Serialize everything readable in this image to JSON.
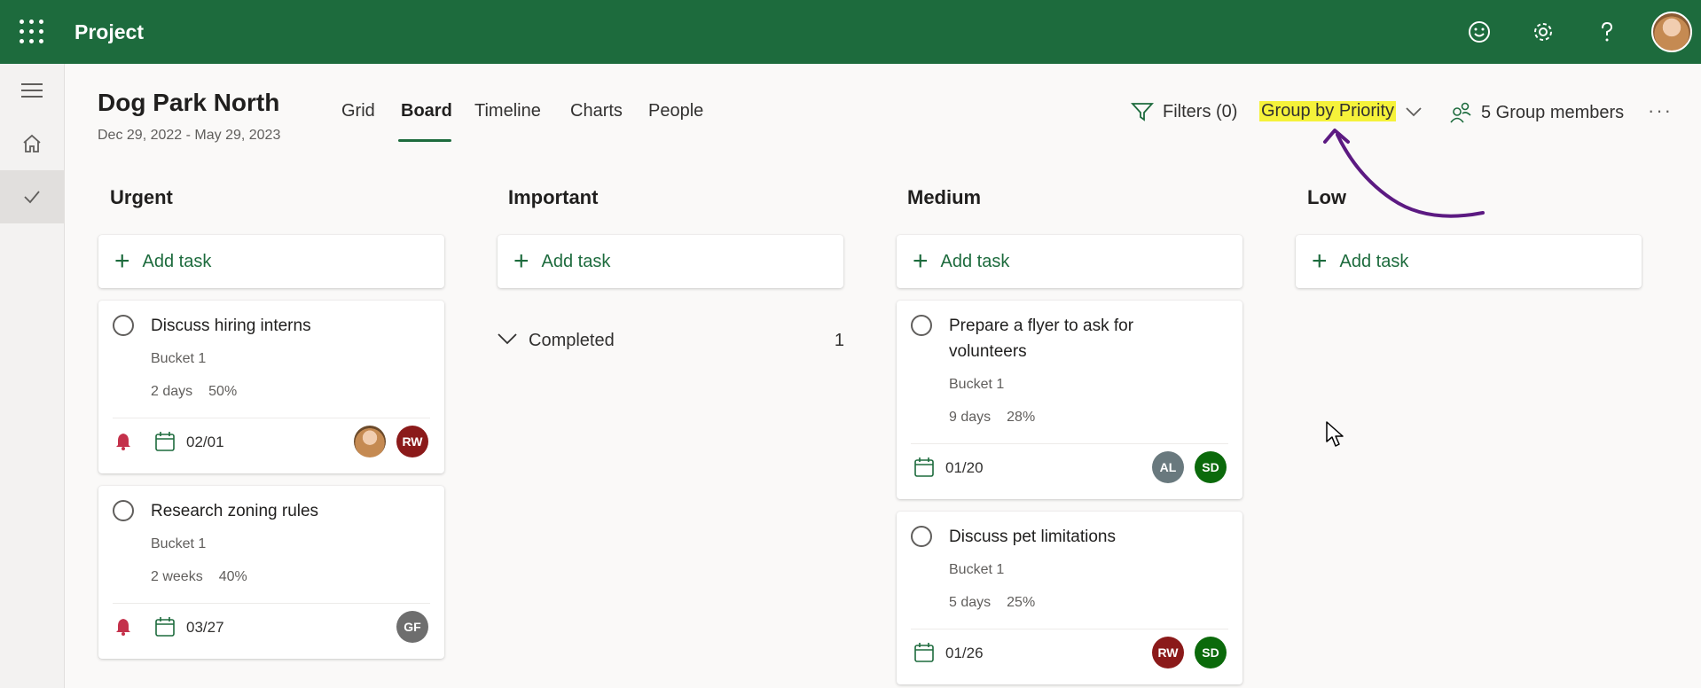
{
  "app": {
    "title": "Project"
  },
  "plan": {
    "title": "Dog Park North",
    "dates": "Dec 29, 2022 - May 29, 2023"
  },
  "tabs": [
    {
      "label": "Grid"
    },
    {
      "label": "Board",
      "active": true
    },
    {
      "label": "Timeline"
    },
    {
      "label": "Charts"
    },
    {
      "label": "People"
    }
  ],
  "toolbar": {
    "filters_label": "Filters (0)",
    "group_by_label": "Group by Priority",
    "members_label": "5 Group members",
    "more_label": "···"
  },
  "add_task_label": "Add task",
  "columns": [
    {
      "title": "Urgent",
      "tasks": [
        {
          "title": "Discuss hiring interns",
          "bucket": "Bucket 1",
          "duration": "2 days",
          "progress": "50%",
          "due": "02/01",
          "assignees": [
            "photo",
            "RW"
          ]
        },
        {
          "title": "Research zoning rules",
          "bucket": "Bucket 1",
          "duration": "2 weeks",
          "progress": "40%",
          "due": "03/27",
          "assignees": [
            "GF"
          ]
        }
      ]
    },
    {
      "title": "Important",
      "completed": {
        "label": "Completed",
        "count": "1"
      }
    },
    {
      "title": "Medium",
      "tasks": [
        {
          "title": "Prepare a flyer to ask for volunteers",
          "bucket": "Bucket 1",
          "duration": "9 days",
          "progress": "28%",
          "due": "01/20",
          "assignees": [
            "AL",
            "SD"
          ]
        },
        {
          "title": "Discuss pet limitations",
          "bucket": "Bucket 1",
          "duration": "5 days",
          "progress": "25%",
          "due": "01/26",
          "assignees": [
            "RW",
            "SD"
          ]
        }
      ]
    },
    {
      "title": "Low"
    }
  ],
  "colors": {
    "brand": "#1d6b3d",
    "urgent_bell": "#c4314b",
    "badge_rw": "#8b1a1a",
    "badge_gf": "#6e6e6e",
    "badge_al": "#69797e",
    "badge_sd": "#0b6a0b",
    "highlight": "#f5f23a",
    "annotation_arrow": "#5c1a82"
  },
  "icons": [
    "waffle-icon",
    "smiley-icon",
    "gear-icon",
    "help-icon",
    "hamburger-icon",
    "home-icon",
    "check-icon",
    "filter-icon",
    "chevron-down-icon",
    "people-icon",
    "plus-icon",
    "bell-icon",
    "calendar-icon"
  ]
}
